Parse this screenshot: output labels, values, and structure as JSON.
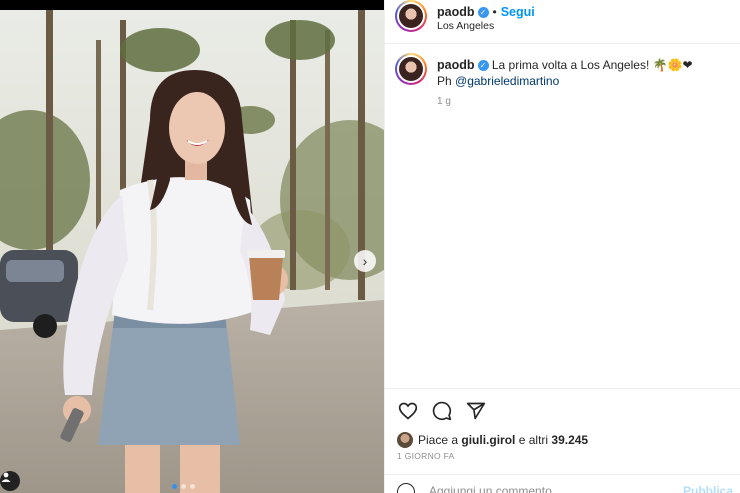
{
  "post": {
    "username": "paodb",
    "verified_glyph": "✓",
    "separator": "•",
    "follow_label": "Segui",
    "location": "Los Angeles",
    "caption": "La prima volta a Los Angeles!",
    "caption_emojis": "🌴🌼❤",
    "credit_prefix": "Ph",
    "credit_mention": "@gabrieledimartino",
    "caption_age": "1 g"
  },
  "carousel": {
    "next_glyph": "›",
    "total_slides": 3,
    "active_slide": 1
  },
  "engagement": {
    "likes_prefix": "Piace a",
    "liked_by": "giuli.girol",
    "likes_joiner": "e altri",
    "likes_count": "39.245",
    "posted_ago": "1 GIORNO FA"
  },
  "comment": {
    "placeholder": "Aggiungi un commento...",
    "post_label": "Pubblica"
  },
  "icons": {
    "like": "heart-icon",
    "comment": "comment-icon",
    "share": "send-icon",
    "emoji": "emoji-icon",
    "user_tag": "user-icon",
    "next": "chevron-right-icon",
    "verified": "verified-badge-icon"
  },
  "colors": {
    "accent": "#0095f6",
    "verified": "#3897f0",
    "mention": "#00376b",
    "muted": "#8e8e8e"
  }
}
